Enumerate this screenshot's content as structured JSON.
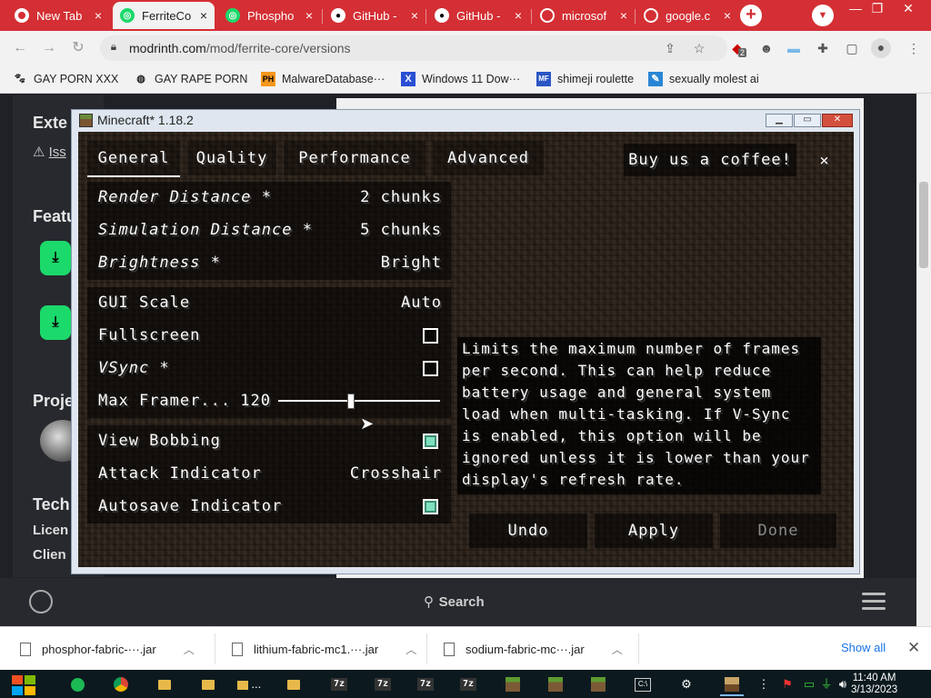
{
  "browser": {
    "tabs": [
      {
        "title": "New Tab",
        "active": false,
        "icon": "chrome-icon"
      },
      {
        "title": "FerriteCo",
        "active": true,
        "icon": "modrinth-icon"
      },
      {
        "title": "Phospho",
        "active": false,
        "icon": "modrinth-icon"
      },
      {
        "title": "GitHub -",
        "active": false,
        "icon": "github-icon"
      },
      {
        "title": "GitHub -",
        "active": false,
        "icon": "github-icon"
      },
      {
        "title": "microsof",
        "active": false,
        "icon": "globe-icon"
      },
      {
        "title": "google.c",
        "active": false,
        "icon": "globe-icon"
      }
    ],
    "url_host": "modrinth.com",
    "url_path": "/mod/ferrite-core/versions",
    "extension_badge": "2",
    "bookmarks": [
      {
        "label": "GAY PORN XXX",
        "icon": "paw-icon"
      },
      {
        "label": "GAY RAPE PORN",
        "icon": "globe-icon"
      },
      {
        "label": "MalwareDatabase···",
        "icon_text": "PH"
      },
      {
        "label": "Windows 11 Dow···",
        "icon_text": "X"
      },
      {
        "label": "shimeji roulette",
        "icon_text": "MF"
      },
      {
        "label": "sexually molest ai",
        "icon_text": "✎"
      }
    ]
  },
  "page": {
    "sections": [
      "Exte",
      "Iss",
      "Featu",
      "Proje",
      "Tech",
      "Licen",
      "Clien"
    ],
    "search_label": "Search"
  },
  "minecraft": {
    "window_title": "Minecraft* 1.18.2",
    "tabs": [
      "General",
      "Quality",
      "Performance",
      "Advanced"
    ],
    "coffee_label": "Buy us a coffee!",
    "close_label": "×",
    "options": [
      {
        "label": "Render Distance *",
        "value": "2 chunks",
        "italic": true
      },
      {
        "label": "Simulation Distance *",
        "value": "5 chunks",
        "italic": true
      },
      {
        "label": "Brightness *",
        "value": "Bright",
        "italic": true
      },
      {
        "label": "GUI Scale",
        "value": "Auto"
      },
      {
        "label": "Fullscreen",
        "checked": false
      },
      {
        "label": "VSync *",
        "checked": false,
        "italic": true
      },
      {
        "label": "Max Framer...",
        "value": "120",
        "slider_fraction": 0.45
      },
      {
        "label": "View Bobbing",
        "checked": true
      },
      {
        "label": "Attack Indicator",
        "value": "Crosshair"
      },
      {
        "label": "Autosave Indicator",
        "checked": true
      }
    ],
    "tooltip": "Limits the maximum number of frames per second. This can help reduce battery usage and general system load when multi-tasking. If V-Sync is enabled, this option will be ignored unless it is lower than your display's refresh rate.",
    "buttons": {
      "undo": "Undo",
      "apply": "Apply",
      "done": "Done"
    }
  },
  "downloads": {
    "items": [
      "phosphor-fabric-···.jar",
      "lithium-fabric-mc1.···.jar",
      "sodium-fabric-mc···.jar"
    ],
    "show_all": "Show all"
  },
  "taskbar": {
    "time": "11:40 AM",
    "date": "3/13/2023",
    "folder_label": "..."
  },
  "colors": {
    "chrome_red": "#d42f34",
    "modrinth_green": "#1bd96a",
    "checkbox_on": "#3c8e72"
  }
}
